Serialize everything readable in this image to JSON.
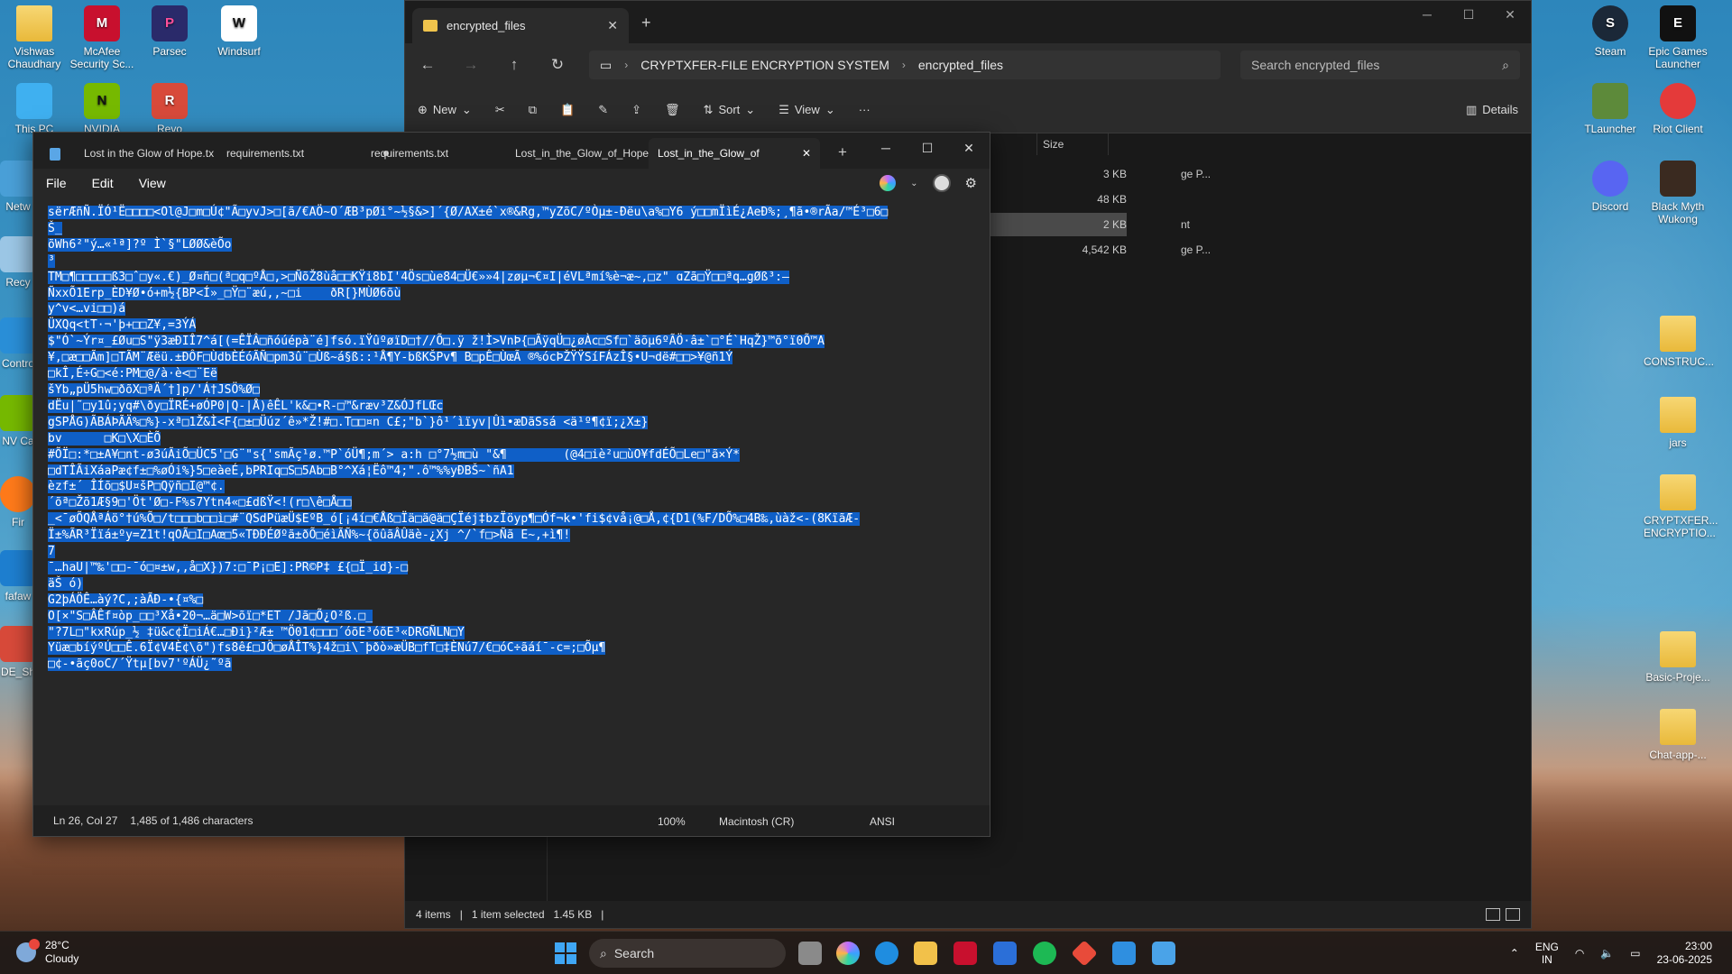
{
  "desktop": {
    "left_icons": [
      {
        "label": "Vishwas Chaudhary",
        "icon": "folder-icon"
      },
      {
        "label": "McAfee Security Sc...",
        "icon": "mcafee-icon"
      },
      {
        "label": "Parsec",
        "icon": "parsec-icon"
      },
      {
        "label": "Windsurf",
        "icon": "windsurf-icon"
      },
      {
        "label": "This PC",
        "icon": "monitor-icon"
      },
      {
        "label": "NVIDIA",
        "icon": "nvidia-icon"
      },
      {
        "label": "Revo",
        "icon": "revo-icon"
      },
      {
        "label": "Netw",
        "icon": "network-icon"
      },
      {
        "label": "Recy",
        "icon": "recycle-bin-icon"
      },
      {
        "label": "Contro",
        "icon": "control-panel-icon"
      },
      {
        "label": "NV Ca",
        "icon": "nvidia-app-icon"
      },
      {
        "label": "Fir",
        "icon": "firefox-icon"
      },
      {
        "label": "fafaw",
        "icon": "app-icon"
      },
      {
        "label": "DE_Sh",
        "icon": "app-icon"
      }
    ],
    "right_icons": [
      {
        "label": "Steam",
        "icon": "steam-icon"
      },
      {
        "label": "Epic Games Launcher",
        "icon": "epic-games-icon"
      },
      {
        "label": "TLauncher",
        "icon": "tlauncher-icon"
      },
      {
        "label": "Riot Client",
        "icon": "riot-icon"
      },
      {
        "label": "Discord",
        "icon": "discord-icon"
      },
      {
        "label": "Black Myth Wukong",
        "icon": "game-icon"
      },
      {
        "label": "CONSTRUC...",
        "icon": "folder-icon"
      },
      {
        "label": "jars",
        "icon": "folder-icon"
      },
      {
        "label": "CRYPTXFER... ENCRYPTIO...",
        "icon": "folder-icon"
      },
      {
        "label": "Basic-Proje...",
        "icon": "folder-icon"
      },
      {
        "label": "Chat-app-...",
        "icon": "folder-icon"
      }
    ]
  },
  "explorer": {
    "tab_title": "encrypted_files",
    "breadcrumb": [
      "CRYPTXFER-FILE ENCRYPTION SYSTEM",
      "encrypted_files"
    ],
    "search_placeholder": "Search encrypted_files",
    "toolbar": {
      "new": "New",
      "sort": "Sort",
      "view": "View",
      "more": "···",
      "details": "Details"
    },
    "column_size": "Size",
    "rows": [
      {
        "type": "ge P...",
        "size": "3 KB",
        "selected": false
      },
      {
        "type": "",
        "size": "48 KB",
        "selected": false
      },
      {
        "type": "nt",
        "size": "2 KB",
        "selected": true
      },
      {
        "type": "ge P...",
        "size": "4,542 KB",
        "selected": false
      }
    ],
    "status": {
      "items": "4 items",
      "selected": "1 item selected",
      "size": "1.45 KB"
    }
  },
  "notepad": {
    "tabs": [
      {
        "label": "Lost in the Glow of Hope.tx",
        "active": false
      },
      {
        "label": "requirements.txt",
        "active": false,
        "modified": true
      },
      {
        "label": "requirements.txt",
        "active": false
      },
      {
        "label": "Lost_in_the_Glow_of_Hope.",
        "active": false
      },
      {
        "label": "Lost_in_the_Glow_of",
        "active": true
      }
    ],
    "menu": {
      "file": "File",
      "edit": "Edit",
      "view": "View"
    },
    "lines": [
      "sërÆñÑ.ÏÓ¹Ë\u0000\u0000\u0000\u0000<Ol@J\u0000m\u0000Ú¢\"Ã\u0000yvJ>\u0000[ã/€AÖ~O´ÆB³pØi°~½§&>]´{Ø/AX±é`x®&Rg,™yZõC/ºÒµ±-Ðëu\\a%\u0000Y6 ý\u0000\u0000mÏìÉ¿AeÐ%;¸¶ã•®rÃa/™É³\u00006\u0000",
      "Š_",
      "õWh6²\"ý…«¹ª]?º Ì`§\"LØØ&èÕo",
      "³",
      "TM\u0000¶\u0000\u0000\u0000\u0000\u0000ß3\u0000ˆ\u0000y«.€)_Ø¤ñ\u0000(ª\u0000q\u0000ºÅ\u0000,>\u0000ÑõŽ8ùå\u0000\u0000KŸi8bI'4Ös\u0000ùe84\u0000Ü€»»4|zøµ¬€¤I|éVLªmí%è¬æ~,\u0000z\" ɑZã\u0000Ÿ\u0000\u0000ªq…gØß³:—",
      "ÑxxÕ1Erp_ÈD¥Ø•ó+m½{BP<Í»_\u0000Ÿ\u0000¨æú,,~\u0000i    ðR[}MÙØ6õù",
      "y^v<…vi\u0000\u0000)á",
      "ÜXQq<tT·¬'þ+\u0000\u0000Z¥,=3ÝÁ",
      "$\"Ó`~Ýr¤_£Øu\u0000S\"ÿ3æÐIÎ7^á[(=ÊÏÂ\u0000ñóúépà¨é]fsó.ïŸûºøïD\u0000†//Õ\u0000.ÿ ž!Ì>VnÞ{\u0000ÃÿqÜ\u0000¿øÀc\u0000Sf\u0000`äõµ6ºÃÖ·â±`\u0000°É`HqŽ}™õ°ï0Õ™A",
      "¥,\u0000æ\u0000\u0000Ãm]\u0000TÃM¨Æëü.±ÐÔF\u0000ÙdbÈÉóÃÑ\u0000pm3û¨\u0000Ùß~á§ß::¹Å¶Y-bßKŠPv¶ B\u0000pÊ\u0000ÙœÃ ®%ócÞŽŸŸSíFÁzÎ§•U¬dë#\u0000\u0000>¥@ñ1Ý",
      "\u0000kÎ,É÷G\u0000<é:PM\u0000@/à·è<\u0000¨Eë",
      "šYb„pÜ5hw\u0000ðõX\u0000ªÄ´†]p/'Á†JSÖ%Ø\u0000",
      "dËu|˜\u0000y1û;yq#\\ðy\u0000ÏRÉ+øÓP0|Q-|Å)êÊL'k&\u0000•R-\u0000™&ræv³Z&ÓJfLŒc",
      "gSPÅG)ÃBÁÞÃÄ%\u0000%}-xª\u00001Ž&Ì<F{\u0000±\u0000Üúz´ê»*Ž!#\u0000.T\u0000\u0000¤n C£;\"b`}ô¹´ìïyv|Ûì•æDãSsá <ä¹º¶¢ï;¿X±}",
      "bv      \u0000K\u0000\\X\u0000ÈÕ",
      "#ÕÏ\u0000:*\u0000±A¥\u0000nt-ø3úÃiÕ\u0000ÜC5'\u0000G¨\"s{'smÃç¹ø.™P`óÜ¶;m´> a:h \u0000°7½m\u0000ù \"&¶        (@4\u0000iè²u\u0000ùO¥fdÉÕ\u0000Le\u0000\"ã×Ý*",
      "\u0000dTÎÃiXáaPæ¢f±\u0000%øÓi%}5\u0000eàeÉ,bPRIq\u0000S\u00005Ab\u0000B°^Xá¦Ëô™4;\".ô™%%yÐBŠ~`ñA1",
      "èzf±´ ÎÍõ\u0000$U¤šP\u0000Qÿñ\u0000I@™¢.",
      "´õª\u0000Žõ1Æ§9\u0000'Öt'Ø\u0000-F%s7Ytn4«\u0000£dßŸ<!(r\u0000\\ê\u0000Å\u0000\u0000",
      "_<¯øÕQÅªÁö°†ú%Õ\u0000/t\u0000\u0000\u0000b\u0000\u0000ì\u0000#¨QSdPüæÜ$EºB_ó[¡4í\u0000€Åß\u0000Ïä\u0000ä@ä\u0000ÇÏéj‡bzÏöyp¶\u0000Óf¬k•'fi$¢vå¡@\u0000Å,¢{D1(%F/DÕ%\u00004B‰,ùàž<-(8KïãÆ-",
      "Ï±%ÃR³Ïïá±ºy=Z1t!qOÃ\u0000I\u0000Aœ\u00005«TÐÐÉØºã±ðÕ\u0000éìÃÑ%~{õûãÂÛäè-¿Xj ^/`f\u0000>Ñã E~,+ì¶!",
      "7",
      "¯…haU|™‰'\u0000\u0000-¯ó\u0000¤±w,,å\u0000X})7:\u0000¯P¡\u0000E]:PR©P‡ £{\u0000Ï_id}-\u0000",
      "äŠ ó)",
      "G2þÁÖÊ…àý?C,;àÃÐ-•{¤%\u0000",
      "O[×\"S\u0000ÂÊf¤òp_\u0000\u0000³Xå•20¬…ä\u0000W>õï\u0000*ET /Jã\u0000Õ¿O²ß.\u0000_",
      "\"?7L\u0000\"kxRúp_½ ‡ü&c¢Ï\u0000iÁ€…\u0000Ði}²Æ± ™Ö01¢\u0000\u0000\u0000´óõE³óõE³«DRGÑLN\u0000Y",
      "Yüæ\u0000bíýºÚ\u0000\u0000Ê.6Ï¢V4È¢\\õ\")fs8ê£\u0000JÖ\u0000øÅÎT%}4ž\u0000i\\¯þðò»æÜB\u0000fT\u0000‡ÈNú7/€\u0000óC÷ãáí¯-c=;\u0000Õµ¶",
      "\u0000¢-•ãç0oC/´Ÿtµ[bv7'ºÁÜ¿˜ºã"
    ],
    "status": {
      "position": "Ln 26, Col 27",
      "chars": "1,485 of 1,486 characters",
      "zoom": "100%",
      "eol": "Macintosh (CR)",
      "encoding": "ANSI"
    }
  },
  "taskbar": {
    "temperature": "28°C",
    "condition": "Cloudy",
    "search_label": "Search",
    "lang_top": "ENG",
    "lang_bottom": "IN",
    "time": "23:00",
    "date": "23-06-2025"
  }
}
